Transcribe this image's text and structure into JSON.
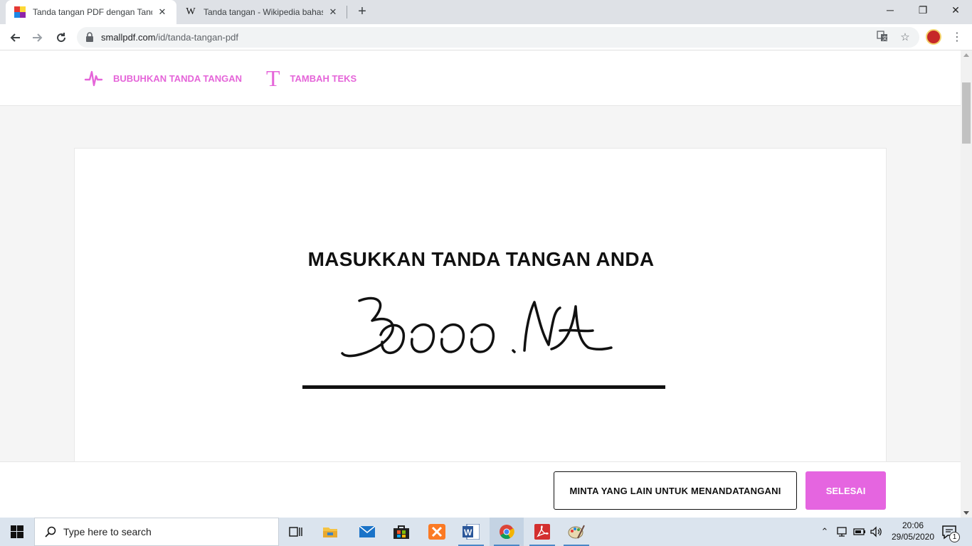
{
  "browser": {
    "tabs": [
      {
        "title": "Tanda tangan PDF dengan Tanda",
        "active": true,
        "favicon": "smallpdf-icon"
      },
      {
        "title": "Tanda tangan - Wikipedia bahasa",
        "active": false,
        "favicon": "wikipedia-icon"
      }
    ],
    "url_host": "smallpdf.com",
    "url_path": "/id/tanda-tangan-pdf",
    "window_controls": {
      "minimize": "─",
      "restore": "❐",
      "close": "✕"
    }
  },
  "header": {
    "sign_label": "BUBUHKAN TANDA TANGAN",
    "text_label": "TAMBAH TEKS",
    "text_icon_glyph": "T"
  },
  "signature_panel": {
    "title": "MASUKKAN TANDA TANGAN ANDA"
  },
  "footer": {
    "request_button": "MINTA YANG LAIN UNTUK MENANDATANGANI",
    "done_button": "SELESAI"
  },
  "taskbar": {
    "search_placeholder": "Type here to search",
    "time": "20:06",
    "date": "29/05/2020",
    "notification_count": "1"
  },
  "colors": {
    "accent": "#e565e0",
    "accent_text": "#e565d9"
  }
}
